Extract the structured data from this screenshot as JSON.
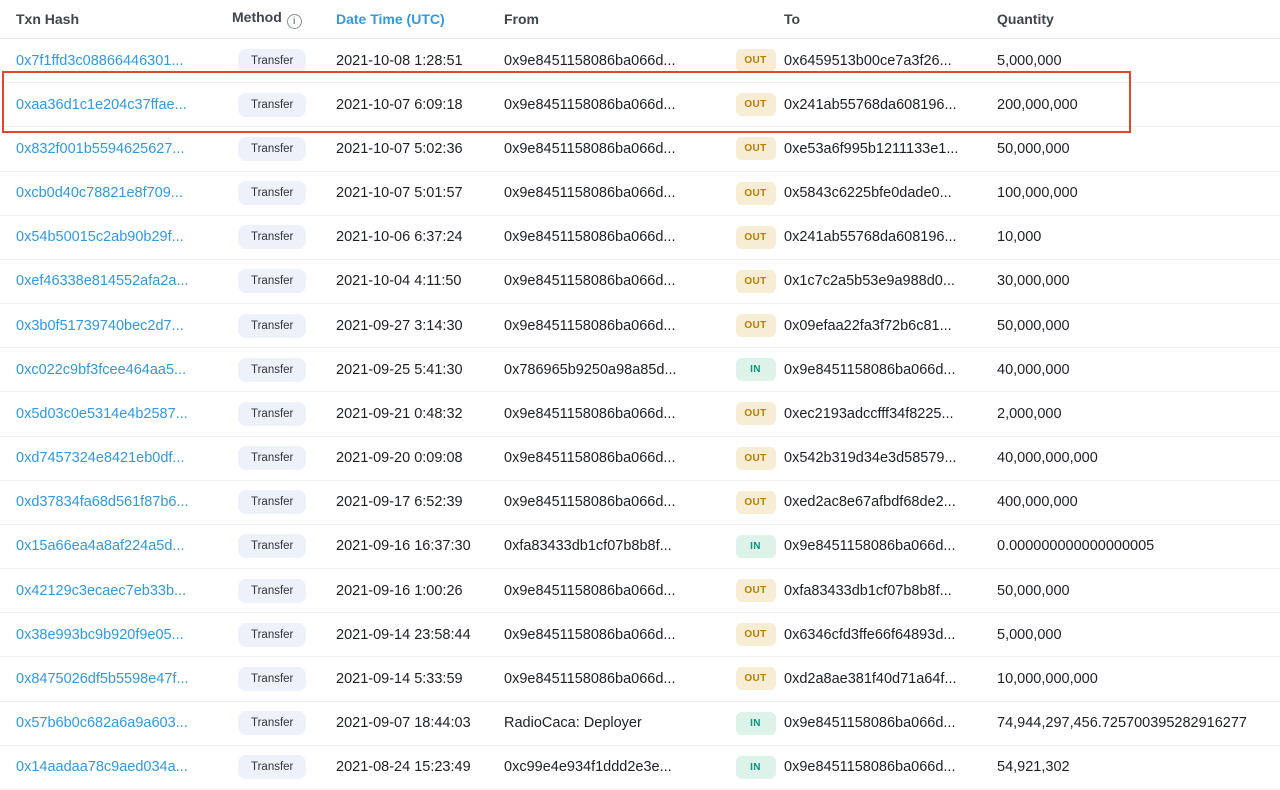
{
  "table": {
    "header": {
      "txn_hash": "Txn Hash",
      "method": "Method",
      "method_info_icon": "i",
      "date_time": "Date Time (UTC)",
      "from": "From",
      "to": "To",
      "quantity": "Quantity"
    },
    "rows": [
      {
        "txn_hash": "0x7f1ffd3c08866446301...",
        "method": "Transfer",
        "date_time": "2021-10-08 1:28:51",
        "from": "0x9e8451158086ba066d...",
        "from_link": false,
        "direction": "OUT",
        "to": "0x6459513b00ce7a3f26...",
        "to_link": true,
        "quantity": "5,000,000",
        "highlighted": false
      },
      {
        "txn_hash": "0xaa36d1c1e204c37ffae...",
        "method": "Transfer",
        "date_time": "2021-10-07 6:09:18",
        "from": "0x9e8451158086ba066d...",
        "from_link": false,
        "direction": "OUT",
        "to": "0x241ab55768da608196...",
        "to_link": true,
        "quantity": "200,000,000",
        "highlighted": true
      },
      {
        "txn_hash": "0x832f001b5594625627...",
        "method": "Transfer",
        "date_time": "2021-10-07 5:02:36",
        "from": "0x9e8451158086ba066d...",
        "from_link": false,
        "direction": "OUT",
        "to": "0xe53a6f995b1211133e1...",
        "to_link": true,
        "quantity": "50,000,000",
        "highlighted": false
      },
      {
        "txn_hash": "0xcb0d40c78821e8f709...",
        "method": "Transfer",
        "date_time": "2021-10-07 5:01:57",
        "from": "0x9e8451158086ba066d...",
        "from_link": false,
        "direction": "OUT",
        "to": "0x5843c6225bfe0dade0...",
        "to_link": true,
        "quantity": "100,000,000",
        "highlighted": false
      },
      {
        "txn_hash": "0x54b50015c2ab90b29f...",
        "method": "Transfer",
        "date_time": "2021-10-06 6:37:24",
        "from": "0x9e8451158086ba066d...",
        "from_link": false,
        "direction": "OUT",
        "to": "0x241ab55768da608196...",
        "to_link": true,
        "quantity": "10,000",
        "highlighted": false
      },
      {
        "txn_hash": "0xef46338e814552afa2a...",
        "method": "Transfer",
        "date_time": "2021-10-04 4:11:50",
        "from": "0x9e8451158086ba066d...",
        "from_link": false,
        "direction": "OUT",
        "to": "0x1c7c2a5b53e9a988d0...",
        "to_link": true,
        "quantity": "30,000,000",
        "highlighted": false
      },
      {
        "txn_hash": "0x3b0f51739740bec2d7...",
        "method": "Transfer",
        "date_time": "2021-09-27 3:14:30",
        "from": "0x9e8451158086ba066d...",
        "from_link": false,
        "direction": "OUT",
        "to": "0x09efaa22fa3f72b6c81...",
        "to_link": true,
        "quantity": "50,000,000",
        "highlighted": false
      },
      {
        "txn_hash": "0xc022c9bf3fcee464aa5...",
        "method": "Transfer",
        "date_time": "2021-09-25 5:41:30",
        "from": "0x786965b9250a98a85d...",
        "from_link": true,
        "direction": "IN",
        "to": "0x9e8451158086ba066d...",
        "to_link": false,
        "quantity": "40,000,000",
        "highlighted": false
      },
      {
        "txn_hash": "0x5d03c0e5314e4b2587...",
        "method": "Transfer",
        "date_time": "2021-09-21 0:48:32",
        "from": "0x9e8451158086ba066d...",
        "from_link": false,
        "direction": "OUT",
        "to": "0xec2193adccfff34f8225...",
        "to_link": true,
        "quantity": "2,000,000",
        "highlighted": false
      },
      {
        "txn_hash": "0xd7457324e8421eb0df...",
        "method": "Transfer",
        "date_time": "2021-09-20 0:09:08",
        "from": "0x9e8451158086ba066d...",
        "from_link": false,
        "direction": "OUT",
        "to": "0x542b319d34e3d58579...",
        "to_link": true,
        "quantity": "40,000,000,000",
        "highlighted": false
      },
      {
        "txn_hash": "0xd37834fa68d561f87b6...",
        "method": "Transfer",
        "date_time": "2021-09-17 6:52:39",
        "from": "0x9e8451158086ba066d...",
        "from_link": false,
        "direction": "OUT",
        "to": "0xed2ac8e67afbdf68de2...",
        "to_link": true,
        "quantity": "400,000,000",
        "highlighted": false
      },
      {
        "txn_hash": "0x15a66ea4a8af224a5d...",
        "method": "Transfer",
        "date_time": "2021-09-16 16:37:30",
        "from": "0xfa83433db1cf07b8b8f...",
        "from_link": true,
        "direction": "IN",
        "to": "0x9e8451158086ba066d...",
        "to_link": false,
        "quantity": "0.000000000000000005",
        "highlighted": false
      },
      {
        "txn_hash": "0x42129c3ecaec7eb33b...",
        "method": "Transfer",
        "date_time": "2021-09-16 1:00:26",
        "from": "0x9e8451158086ba066d...",
        "from_link": false,
        "direction": "OUT",
        "to": "0xfa83433db1cf07b8b8f...",
        "to_link": true,
        "quantity": "50,000,000",
        "highlighted": false
      },
      {
        "txn_hash": "0x38e993bc9b920f9e05...",
        "method": "Transfer",
        "date_time": "2021-09-14 23:58:44",
        "from": "0x9e8451158086ba066d...",
        "from_link": false,
        "direction": "OUT",
        "to": "0x6346cfd3ffe66f64893d...",
        "to_link": true,
        "quantity": "5,000,000",
        "highlighted": false
      },
      {
        "txn_hash": "0x8475026df5b5598e47f...",
        "method": "Transfer",
        "date_time": "2021-09-14 5:33:59",
        "from": "0x9e8451158086ba066d...",
        "from_link": false,
        "direction": "OUT",
        "to": "0xd2a8ae381f40d71a64f...",
        "to_link": true,
        "quantity": "10,000,000,000",
        "highlighted": false
      },
      {
        "txn_hash": "0x57b6b0c682a6a9a603...",
        "method": "Transfer",
        "date_time": "2021-09-07 18:44:03",
        "from": "RadioCaca: Deployer",
        "from_link": true,
        "direction": "IN",
        "to": "0x9e8451158086ba066d...",
        "to_link": false,
        "quantity": "74,944,297,456.725700395282916277",
        "highlighted": false
      },
      {
        "txn_hash": "0x14aadaa78c9aed034a...",
        "method": "Transfer",
        "date_time": "2021-08-24 15:23:49",
        "from": "0xc99e4e934f1ddd2e3e...",
        "from_link": true,
        "direction": "IN",
        "to": "0x9e8451158086ba066d...",
        "to_link": false,
        "quantity": "54,921,302",
        "highlighted": false
      }
    ]
  },
  "colors": {
    "link_blue": "#3498db",
    "text_dark": "#1d2023",
    "header_text": "#40454c",
    "out_badge_bg": "#f7ecd4",
    "out_badge_text": "#b47d00",
    "in_badge_bg": "#ddf2e8",
    "in_badge_text": "#02977e",
    "method_badge_bg": "#eef1f9",
    "highlight_red": "#e5442d",
    "row_border": "#eef0f5"
  }
}
